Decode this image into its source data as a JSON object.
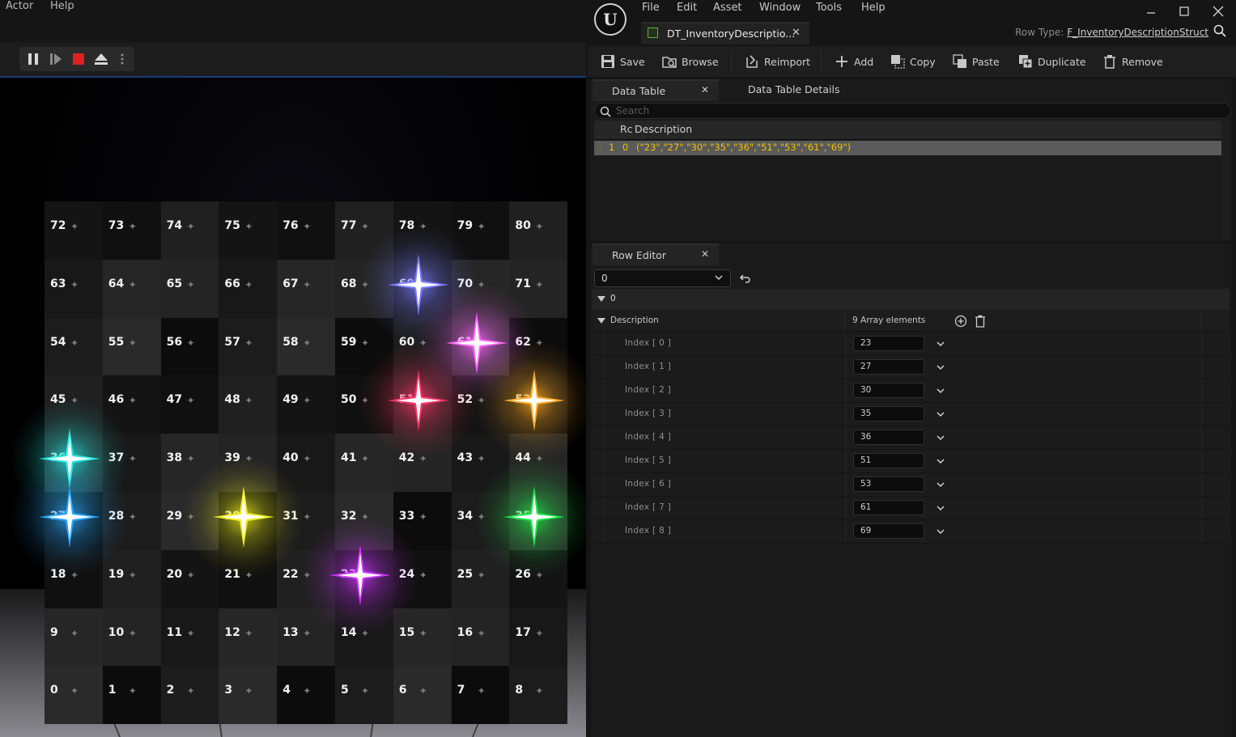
{
  "left_editor": {
    "menu": [
      "Actor",
      "Help"
    ],
    "play_controls": [
      "pause-icon",
      "step-icon",
      "stop-icon",
      "eject-icon",
      "more-icon"
    ],
    "cells": [
      "72",
      "73",
      "74",
      "75",
      "76",
      "77",
      "78",
      "79",
      "80",
      "63",
      "64",
      "65",
      "66",
      "67",
      "68",
      "69",
      "70",
      "71",
      "54",
      "55",
      "56",
      "57",
      "58",
      "59",
      "60",
      "61",
      "62",
      "45",
      "46",
      "47",
      "48",
      "49",
      "50",
      "51",
      "52",
      "53",
      "36",
      "37",
      "38",
      "39",
      "40",
      "41",
      "42",
      "43",
      "44",
      "27",
      "28",
      "29",
      "30",
      "31",
      "32",
      "33",
      "34",
      "35",
      "18",
      "19",
      "20",
      "21",
      "22",
      "23",
      "24",
      "25",
      "26",
      "9",
      "10",
      "11",
      "12",
      "13",
      "14",
      "15",
      "16",
      "17",
      "0",
      "1",
      "2",
      "3",
      "4",
      "5",
      "6",
      "7",
      "8"
    ],
    "highlighted": [
      {
        "cell": "69",
        "color": "#7a7aff"
      },
      {
        "cell": "61",
        "color": "#ff66ff"
      },
      {
        "cell": "51",
        "color": "#ff3366"
      },
      {
        "cell": "53",
        "color": "#ffaa22"
      },
      {
        "cell": "36",
        "color": "#22e8e0"
      },
      {
        "cell": "27",
        "color": "#2aa8ff"
      },
      {
        "cell": "30",
        "color": "#f0f020"
      },
      {
        "cell": "35",
        "color": "#22e64a"
      },
      {
        "cell": "23",
        "color": "#cc33ff"
      }
    ]
  },
  "right_editor": {
    "menu": [
      "File",
      "Edit",
      "Asset",
      "Window",
      "Tools",
      "Help"
    ],
    "asset_tab": "DT_InventoryDescriptio...",
    "row_type_label": "Row Type:",
    "row_type_value": "F_InventoryDescriptionStruct",
    "toolbar": [
      {
        "label": "Save",
        "icon": "save-icon"
      },
      {
        "label": "Browse",
        "icon": "browse-icon"
      },
      {
        "label": "Reimport",
        "icon": "reimport-icon"
      },
      {
        "label": "Add",
        "icon": "add-icon"
      },
      {
        "label": "Copy",
        "icon": "copy-icon"
      },
      {
        "label": "Paste",
        "icon": "paste-icon"
      },
      {
        "label": "Duplicate",
        "icon": "duplicate-icon"
      },
      {
        "label": "Remove",
        "icon": "remove-icon"
      }
    ],
    "data_table_tab": "Data Table",
    "details_tab": "Data Table Details",
    "search_placeholder": "Search",
    "table_header_rowname": "Rc",
    "table_header_desc": "Description",
    "row": {
      "index": "1",
      "name": "0",
      "value": "(\"23\",\"27\",\"30\",\"35\",\"36\",\"51\",\"53\",\"61\",\"69\")"
    },
    "row_editor_tab": "Row Editor",
    "row_selector_value": "0",
    "category": "0",
    "property_name": "Description",
    "array_count": "9 Array elements",
    "elements": [
      {
        "label": "Index [ 0 ]",
        "value": "23"
      },
      {
        "label": "Index [ 1 ]",
        "value": "27"
      },
      {
        "label": "Index [ 2 ]",
        "value": "30"
      },
      {
        "label": "Index [ 3 ]",
        "value": "35"
      },
      {
        "label": "Index [ 4 ]",
        "value": "36"
      },
      {
        "label": "Index [ 5 ]",
        "value": "51"
      },
      {
        "label": "Index [ 6 ]",
        "value": "53"
      },
      {
        "label": "Index [ 7 ]",
        "value": "61"
      },
      {
        "label": "Index [ 8 ]",
        "value": "69"
      }
    ]
  }
}
